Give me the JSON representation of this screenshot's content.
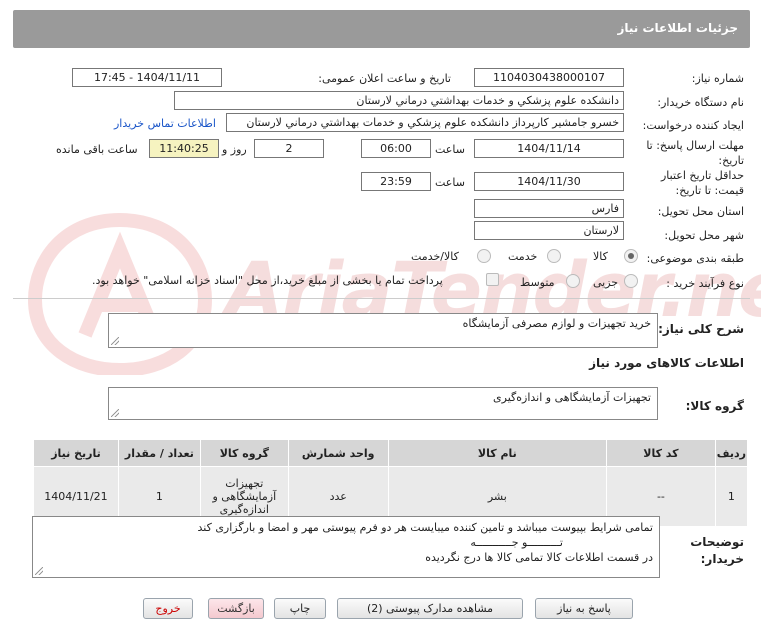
{
  "header": {
    "title": "جزئیات اطلاعات نیاز"
  },
  "form": {
    "need_number_label": "شماره نیاز:",
    "need_number": "1104030438000107",
    "announce_label": "تاریخ و ساعت اعلان عمومی:",
    "announce_value": "1404/11/11 - 17:45",
    "buyer_org_label": "نام دستگاه خریدار:",
    "buyer_org": "دانشکده علوم پزشکي و خدمات بهداشتي  درماني لارستان",
    "requester_label": "ایجاد کننده درخواست:",
    "requester": "خسرو جامشیر کارپرداز دانشکده علوم پزشکي و خدمات بهداشتي  درماني لارستان",
    "buyer_contact_link": "اطلاعات تماس خریدار",
    "deadline_label_1": "مهلت ارسال پاسخ: تا",
    "deadline_label_2": "تاریخ:",
    "deadline_date": "1404/11/14",
    "time_label": "ساعت",
    "deadline_time": "06:00",
    "days_value": "2",
    "days_and_label": "روز و",
    "remaining_time": "11:40:25",
    "remaining_label": "ساعت باقی مانده",
    "validity_label_1": "حداقل تاریخ اعتبار",
    "validity_label_2": "قیمت: تا تاریخ:",
    "validity_date": "1404/11/30",
    "validity_time": "23:59",
    "province_label": "استان محل تحویل:",
    "province": "فارس",
    "city_label": "شهر محل تحویل:",
    "city": "لارستان",
    "category_label": "طبقه بندی موضوعی:",
    "category_options": [
      "کالا",
      "خدمت",
      "کالا/خدمت"
    ],
    "process_label": "نوع فرآیند خرید :",
    "process_options": [
      "جزیی",
      "متوسط"
    ],
    "payment_note": "پرداخت تمام یا بخشی از مبلغ خرید،از محل \"اسناد خزانه اسلامی\" خواهد بود."
  },
  "description": {
    "label": "شرح کلی نیاز:",
    "value": "خرید تجهیزات و لوازم مصرفی آزمایشگاه"
  },
  "goods_section": {
    "title": "اطلاعات کالاهای مورد نیاز",
    "group_label": "گروه کالا:",
    "group_value": "تجهیزات آزمایشگاهی و اندازه‌گیری"
  },
  "table": {
    "headers": [
      "ردیف",
      "کد کالا",
      "نام کالا",
      "واحد شمارش",
      "گروه کالا",
      "تعداد / مقدار",
      "تاریخ نیاز"
    ],
    "rows": [
      {
        "row": "1",
        "code": "--",
        "name": "بشر",
        "unit": "عدد",
        "group": "تجهیزات آزمایشگاهی و اندازه‌گیری",
        "qty": "1",
        "date": "1404/11/21"
      }
    ]
  },
  "buyer_notes": {
    "label_1": "توضیحات",
    "label_2": "خریدار:",
    "lines": [
      "تمامی شرایط بپیوست میباشد و تامین کننده میبایست هر دو فرم پیوستی مهر و امضا و بارگزاری کند",
      "تــــــــــو جـــــــــــه",
      "در قسمت اطلاعات کالا تمامی کالا ها درج نگردیده"
    ]
  },
  "buttons": {
    "reply": "پاسخ به نیاز",
    "attachments": "مشاهده مدارک پیوستی (2)",
    "print": "چاپ",
    "back": "بازگشت",
    "exit": "خروج"
  },
  "watermark": {
    "text": "AriaTender.neT"
  },
  "colors": {
    "header_bg": "#9a9a9a",
    "link": "#1a55c8",
    "remaining_bg": "#f6f3c0",
    "exit_red": "#cc0000"
  }
}
